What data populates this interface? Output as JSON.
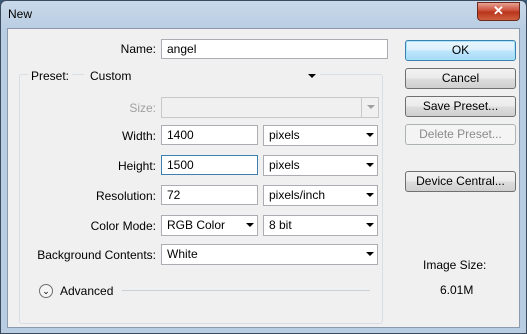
{
  "window": {
    "title": "New",
    "close_glyph": "✕"
  },
  "fields": {
    "name": {
      "label": "Name:",
      "value": "angel"
    },
    "preset": {
      "label": "Preset:",
      "value": "Custom"
    },
    "size": {
      "label": "Size:",
      "value": ""
    },
    "width": {
      "label": "Width:",
      "value": "1400",
      "unit": "pixels"
    },
    "height": {
      "label": "Height:",
      "value": "1500",
      "unit": "pixels"
    },
    "resolution": {
      "label": "Resolution:",
      "value": "72",
      "unit": "pixels/inch"
    },
    "color_mode": {
      "label": "Color Mode:",
      "value": "RGB Color",
      "depth": "8 bit"
    },
    "background": {
      "label": "Background Contents:",
      "value": "White"
    }
  },
  "advanced": {
    "label": "Advanced",
    "icon": "chevron-double-down-icon",
    "glyph": "⌄"
  },
  "buttons": {
    "ok": "OK",
    "cancel": "Cancel",
    "save_preset": "Save Preset...",
    "delete_preset": "Delete Preset...",
    "device_central": "Device Central..."
  },
  "image_size": {
    "label": "Image Size:",
    "value": "6.01M"
  }
}
